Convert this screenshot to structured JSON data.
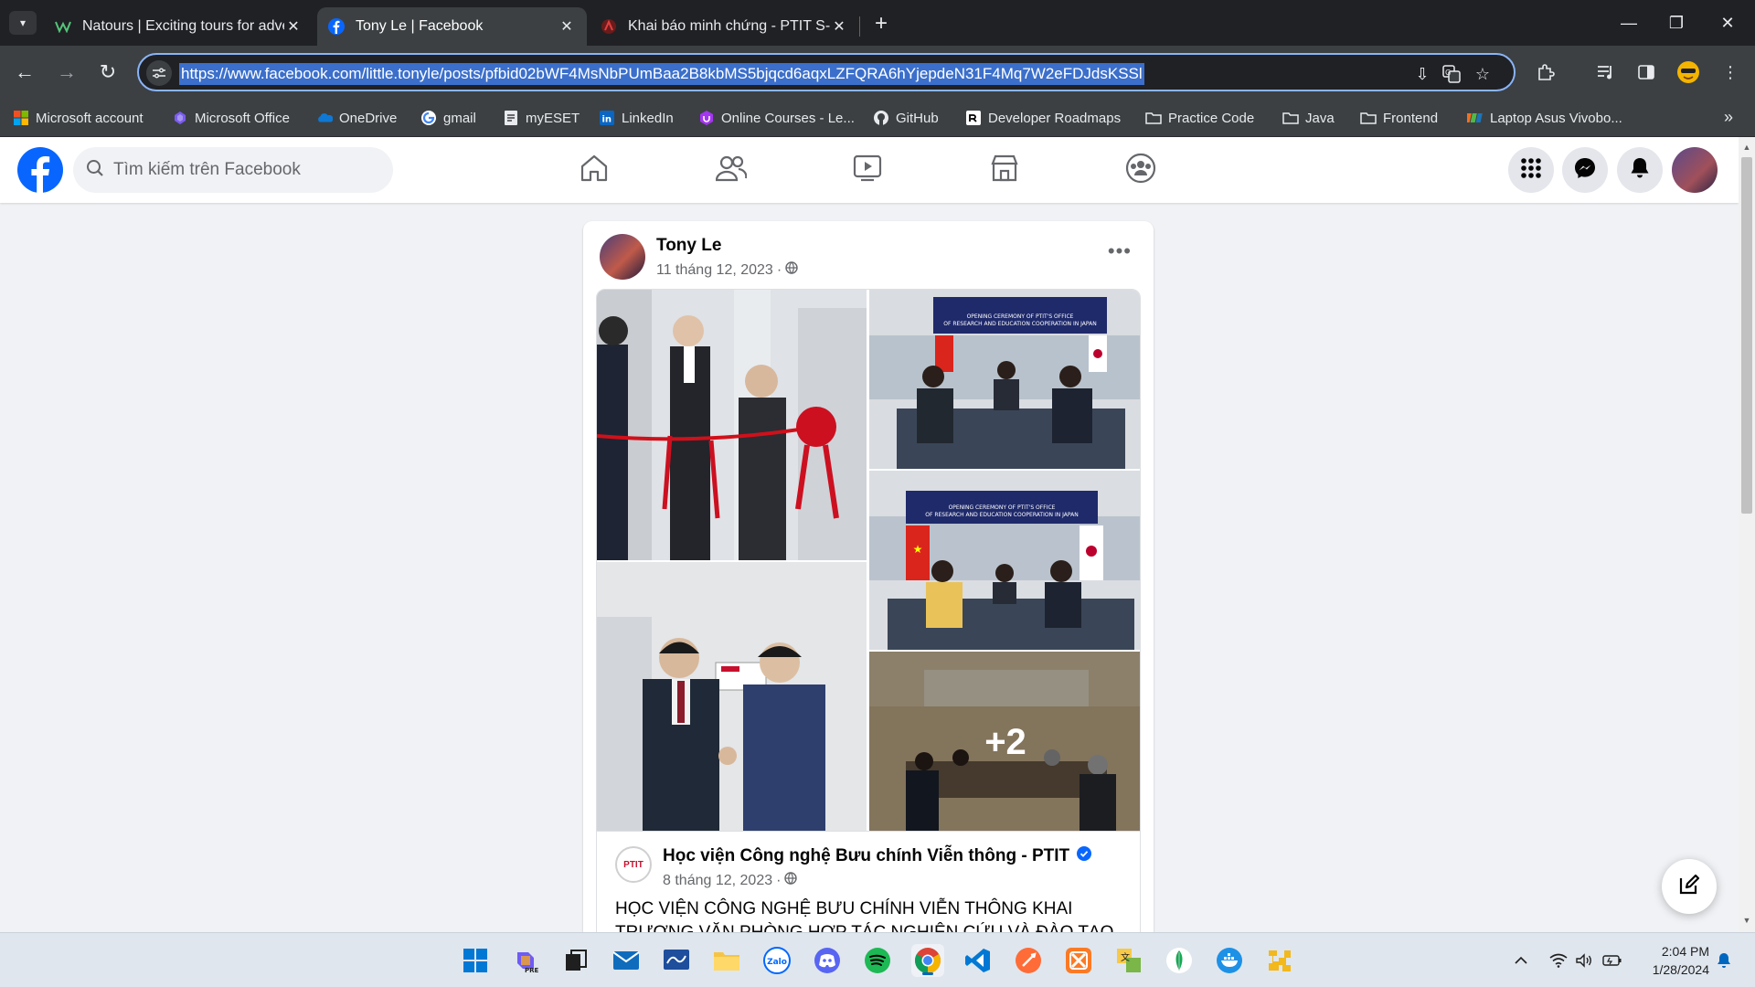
{
  "browser": {
    "tabs": [
      {
        "title": "Natours | Exciting tours for adventurous people",
        "favicon": "natours-icon",
        "active": false
      },
      {
        "title": "Tony Le | Facebook",
        "favicon": "facebook-icon",
        "active": true
      },
      {
        "title": "Khai báo minh chứng - PTIT S-Link",
        "favicon": "ptit-icon",
        "active": false
      }
    ],
    "url": "https://www.facebook.com/little.tonyle/posts/pfbid02bWF4MsNbPUmBaa2B8kbMS5bjqcd6aqxLZFQRA6hYjepdeN31F4Mq7W2eFDJdsKSSl",
    "bookmarks": [
      {
        "label": "Microsoft account",
        "icon": "microsoft-icon"
      },
      {
        "label": "Microsoft Office",
        "icon": "office-icon"
      },
      {
        "label": "OneDrive",
        "icon": "onedrive-icon"
      },
      {
        "label": "gmail",
        "icon": "google-icon"
      },
      {
        "label": "myESET",
        "icon": "eset-icon"
      },
      {
        "label": "LinkedIn",
        "icon": "linkedin-icon"
      },
      {
        "label": "Online Courses - Le...",
        "icon": "udemy-icon"
      },
      {
        "label": "GitHub",
        "icon": "github-icon"
      },
      {
        "label": "Developer Roadmaps",
        "icon": "roadmap-icon"
      },
      {
        "label": "Practice Code",
        "icon": "folder-icon"
      },
      {
        "label": "Java",
        "icon": "folder-icon"
      },
      {
        "label": "Frontend",
        "icon": "folder-icon"
      },
      {
        "label": "Laptop Asus Vivobo...",
        "icon": "fpt-icon"
      }
    ]
  },
  "facebook": {
    "search_placeholder": "Tìm kiếm trên Facebook",
    "nav": [
      "home-icon",
      "friends-icon",
      "video-icon",
      "marketplace-icon",
      "groups-icon"
    ],
    "post": {
      "author": "Tony Le",
      "date": "11 tháng 12, 2023",
      "more_photos": "+2",
      "shared": {
        "page_name": "Học viện Công nghệ Bưu chính Viễn thông - PTIT",
        "logo_text": "PTIT",
        "date": "8 tháng 12, 2023",
        "text": "HỌC VIỆN CÔNG NGHỆ BƯU CHÍNH VIỄN THÔNG KHAI TRƯƠNG VĂN PHÒNG HỢP TÁC NGHIÊN CỨU VÀ ĐÀO TẠO TẠI NHẬT BẢN"
      },
      "photo_captions": {
        "banner_1": "OPENING CEREMONY OF PTIT'S OFFICE OF RESEARCH AND EDUCATION COOPERATION IN JAPAN",
        "banner_2": "OPENING CEREMONY OF PTIT'S OFFICE OF RESEARCH AND EDUCATION COOPERATION IN JAPAN"
      }
    }
  },
  "taskbar": {
    "time": "2:04 PM",
    "date": "1/28/2024"
  },
  "colors": {
    "facebook_blue": "#0866ff",
    "chrome_dark": "#202124",
    "chrome_toolbar": "#3c4043"
  }
}
